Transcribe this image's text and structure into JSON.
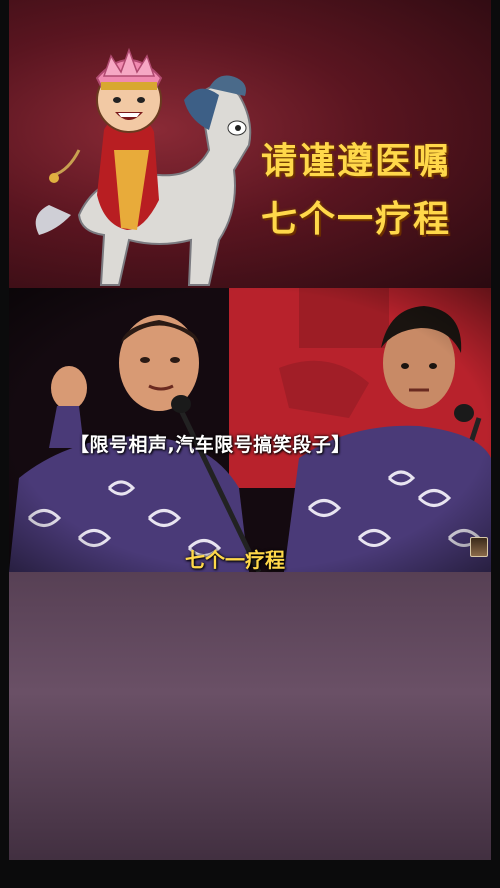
{
  "poster": {
    "title_line1": "请谨遵医嘱",
    "title_line2": "七个一疗程"
  },
  "video": {
    "hashtag_caption": "【限号相声,汽车限号搞笑段子】",
    "subtitle": "七个一疗程"
  },
  "colors": {
    "title_yellow": "#ffd84a",
    "poster_red": "#5a1520",
    "gown_blue": "#4a3a78"
  },
  "icons": {
    "avatar": "uploader-avatar-icon"
  }
}
